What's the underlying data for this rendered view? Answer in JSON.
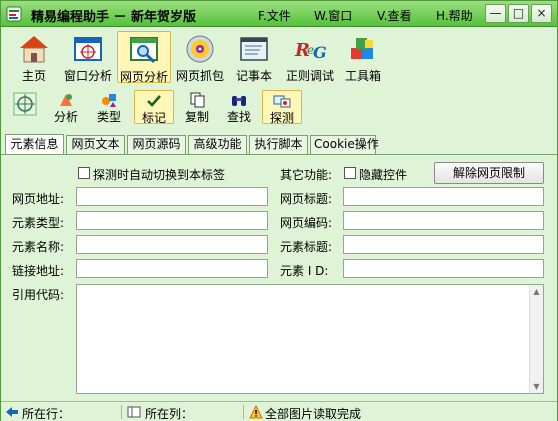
{
  "title": "精易编程助手 － 新年贺岁版",
  "menu": [
    "F.文件",
    "W.窗口",
    "V.查看",
    "H.帮助"
  ],
  "window_buttons": {
    "minimize": "—",
    "restore": "□",
    "close": "×"
  },
  "toolbar": [
    {
      "label": "主页",
      "icon": "home-icon"
    },
    {
      "label": "窗口分析",
      "icon": "window-analysis-icon"
    },
    {
      "label": "网页分析",
      "icon": "web-analysis-icon",
      "active": true
    },
    {
      "label": "网页抓包",
      "icon": "packet-capture-icon"
    },
    {
      "label": "记事本",
      "icon": "notepad-icon"
    },
    {
      "label": "正则调试",
      "icon": "regex-icon"
    },
    {
      "label": "工具箱",
      "icon": "toolbox-icon"
    }
  ],
  "subtoolbar": [
    {
      "label": "",
      "icon": "crosshair-icon"
    },
    {
      "label": "分析",
      "icon": "analyze-icon"
    },
    {
      "label": "类型",
      "icon": "type-icon"
    },
    {
      "label": "标记",
      "icon": "checkmark-icon",
      "active": true
    },
    {
      "label": "复制",
      "icon": "copy-icon"
    },
    {
      "label": "查找",
      "icon": "binoculars-icon"
    },
    {
      "label": "探测",
      "icon": "probe-icon",
      "active": true
    }
  ],
  "tabs": [
    "元素信息",
    "网页文本",
    "网页源码",
    "高级功能",
    "执行脚本",
    "Cookie操作"
  ],
  "active_tab": "元素信息",
  "form": {
    "auto_switch_label": "探测时自动切换到本标签",
    "other_label": "其它功能:",
    "hide_controls_label": "隐藏控件",
    "unlock_button": "解除网页限制",
    "left_fields": [
      {
        "label": "网页地址:",
        "value": ""
      },
      {
        "label": "元素类型:",
        "value": ""
      },
      {
        "label": "元素名称:",
        "value": ""
      },
      {
        "label": "链接地址:",
        "value": ""
      }
    ],
    "right_fields": [
      {
        "label": "网页标题:",
        "value": ""
      },
      {
        "label": "网页编码:",
        "value": ""
      },
      {
        "label": "元素标题:",
        "value": ""
      },
      {
        "label": "元素 I D:",
        "value": ""
      }
    ],
    "code_label": "引用代码:",
    "code_value": ""
  },
  "status": {
    "row_label": "所在行：",
    "col_label": "所在列：",
    "message": "全部图片读取完成"
  },
  "colors": {
    "accent": "#55c13b",
    "background": "#dff3d6",
    "active_tool": "#fff6b8"
  }
}
